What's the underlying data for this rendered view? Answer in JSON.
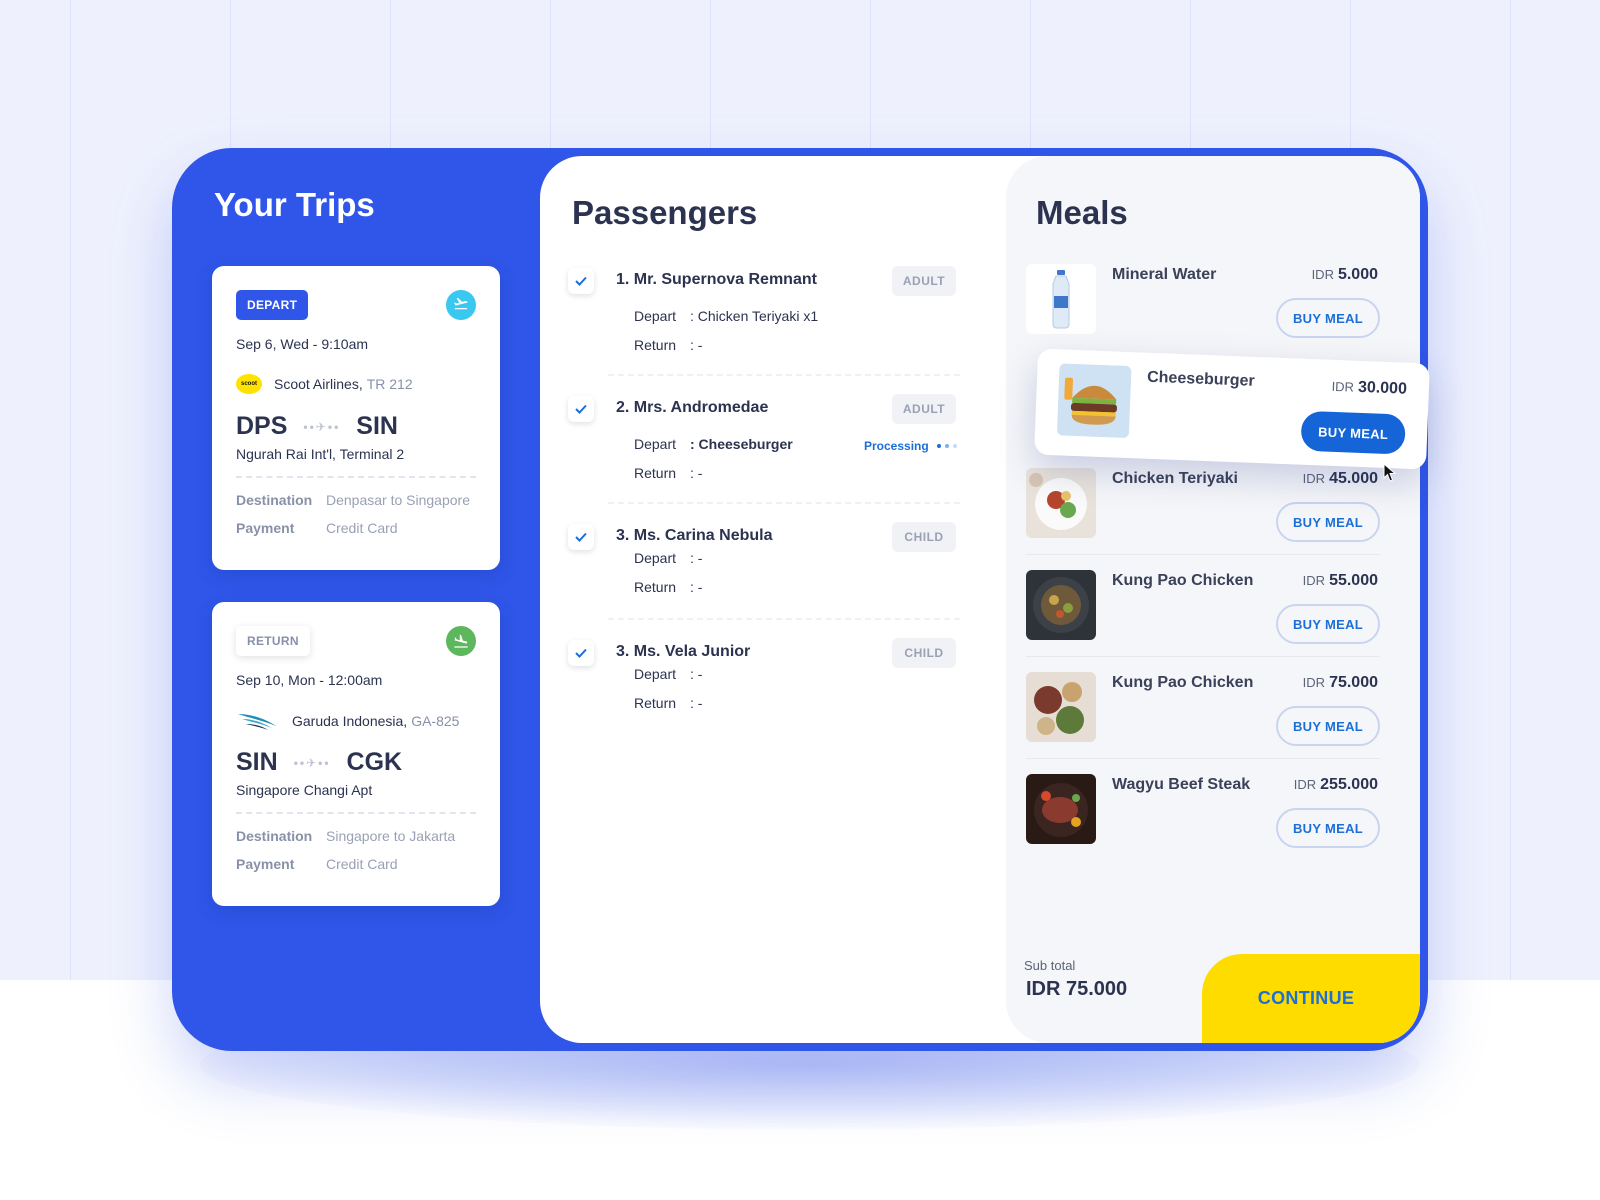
{
  "trips": {
    "title": "Your Trips",
    "depart": {
      "badge": "DEPART",
      "icon": "plane-takeoff-icon",
      "date": "Sep 6, Wed - 9:10am",
      "airline_logo_text": "scoot",
      "airline": "Scoot Airlines,",
      "flight_code": "TR 212",
      "from": "DPS",
      "to": "SIN",
      "terminal": "Ngurah Rai Int'l, Terminal 2",
      "destination_label": "Destination",
      "destination": "Denpasar to Singapore",
      "payment_label": "Payment",
      "payment": "Credit Card"
    },
    "return": {
      "badge": "RETURN",
      "icon": "plane-landing-icon",
      "date": "Sep 10, Mon - 12:00am",
      "airline": "Garuda Indonesia,",
      "flight_code": "GA-825",
      "from": "SIN",
      "to": "CGK",
      "terminal": "Singapore Changi Apt",
      "destination_label": "Destination",
      "destination": "Singapore to Jakarta",
      "payment_label": "Payment",
      "payment": "Credit Card"
    }
  },
  "passengers": {
    "title": "Passengers",
    "depart_label": "Depart",
    "return_label": "Return",
    "items": [
      {
        "name": "1. Mr. Supernova Remnant",
        "type": "ADULT",
        "depart": ": Chicken Teriyaki x1",
        "return": ": -"
      },
      {
        "name": "2. Mrs. Andromedae",
        "type": "ADULT",
        "depart": ": Cheeseburger",
        "return": ": -",
        "status": "Processing"
      },
      {
        "name": "3. Ms. Carina Nebula",
        "type": "CHILD",
        "depart": ": -",
        "return": ": -"
      },
      {
        "name": "3. Ms. Vela Junior",
        "type": "CHILD",
        "depart": ": -",
        "return": ": -"
      }
    ]
  },
  "meals": {
    "title": "Meals",
    "currency": "IDR",
    "buy_label": "BUY MEAL",
    "items": [
      {
        "name": "Mineral Water",
        "price": "5.000"
      },
      {
        "name": "Cheeseburger",
        "price": "30.000"
      },
      {
        "name": "Chicken Teriyaki",
        "price": "45.000"
      },
      {
        "name": "Kung Pao Chicken",
        "price": "55.000"
      },
      {
        "name": "Kung Pao Chicken",
        "price": "75.000"
      },
      {
        "name": "Wagyu Beef Steak",
        "price": "255.000"
      }
    ]
  },
  "summary": {
    "subtotal_label": "Sub total",
    "subtotal_value": "IDR 75.000",
    "continue_label": "CONTINUE"
  },
  "colors": {
    "primary": "#2f56e8",
    "accent_blue": "#1565d8",
    "continue_yellow": "#ffdc00",
    "return_icon_green": "#5db75d",
    "depart_icon_cyan": "#3bc8f0"
  }
}
